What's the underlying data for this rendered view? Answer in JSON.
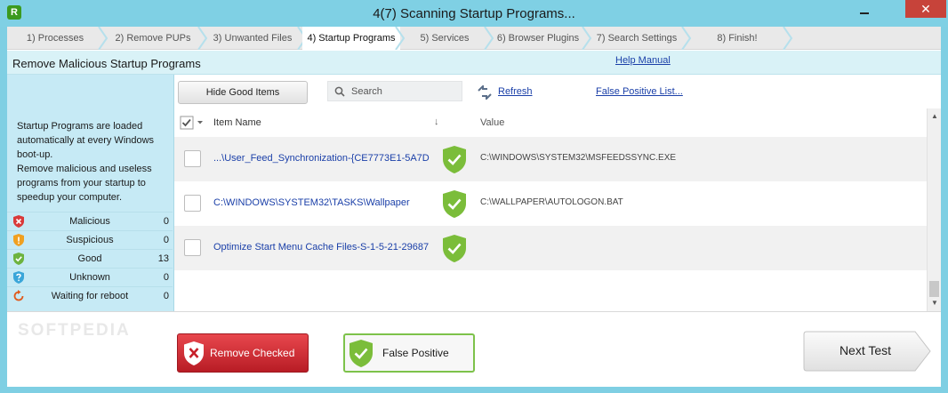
{
  "window": {
    "title": "4(7) Scanning Startup Programs...",
    "app_icon": "R",
    "minimize": "–",
    "close": "✕"
  },
  "steps": [
    {
      "label": "1) Processes"
    },
    {
      "label": "2) Remove PUPs"
    },
    {
      "label": "3) Unwanted Files"
    },
    {
      "label": "4) Startup Programs",
      "active": true
    },
    {
      "label": "5) Services"
    },
    {
      "label": "6) Browser Plugins"
    },
    {
      "label": "7) Search Settings"
    },
    {
      "label": "8) Finish!"
    }
  ],
  "header": {
    "title": "Remove Malicious Startup Programs",
    "help": "Help Manual"
  },
  "info": {
    "description": "Startup Programs are loaded automatically at every Windows boot-up.\nRemove malicious and useless programs from your startup to speedup your computer."
  },
  "stats": [
    {
      "label": "Malicious",
      "count": "0",
      "icon": "malicious-shield-icon",
      "color": "#d93a3a"
    },
    {
      "label": "Suspicious",
      "count": "0",
      "icon": "suspicious-shield-icon",
      "color": "#f0a020"
    },
    {
      "label": "Good",
      "count": "13",
      "icon": "good-shield-icon",
      "color": "#6db33f"
    },
    {
      "label": "Unknown",
      "count": "0",
      "icon": "unknown-shield-icon",
      "color": "#3aa6d9"
    },
    {
      "label": "Waiting for reboot",
      "count": "0",
      "icon": "reboot-icon",
      "color": "#e05a1c"
    }
  ],
  "toolbar": {
    "hide_good": "Hide Good Items",
    "search_placeholder": "Search",
    "refresh": "Refresh",
    "false_positive_list": "False Positive List..."
  },
  "table": {
    "col_name": "Item Name",
    "col_sort": "↓",
    "col_value": "Value",
    "rows": [
      {
        "name": "...\\User_Feed_Synchronization-{CE7773E1-5A7D",
        "value": "C:\\WINDOWS\\SYSTEM32\\MSFEEDSSYNC.EXE"
      },
      {
        "name": "C:\\WINDOWS\\SYSTEM32\\TASKS\\Wallpaper",
        "value": "C:\\WALLPAPER\\AUTOLOGON.BAT"
      },
      {
        "name": "Optimize Start Menu Cache Files-S-1-5-21-29687",
        "value": ""
      }
    ]
  },
  "buttons": {
    "remove_checked": "Remove Checked",
    "false_positive": "False Positive",
    "next_test": "Next Test"
  },
  "watermark": "SOFTPEDIA",
  "colors": {
    "accent": "#7fcfe3",
    "good": "#6db33f",
    "danger": "#c7202a",
    "link": "#1a3fa8"
  }
}
